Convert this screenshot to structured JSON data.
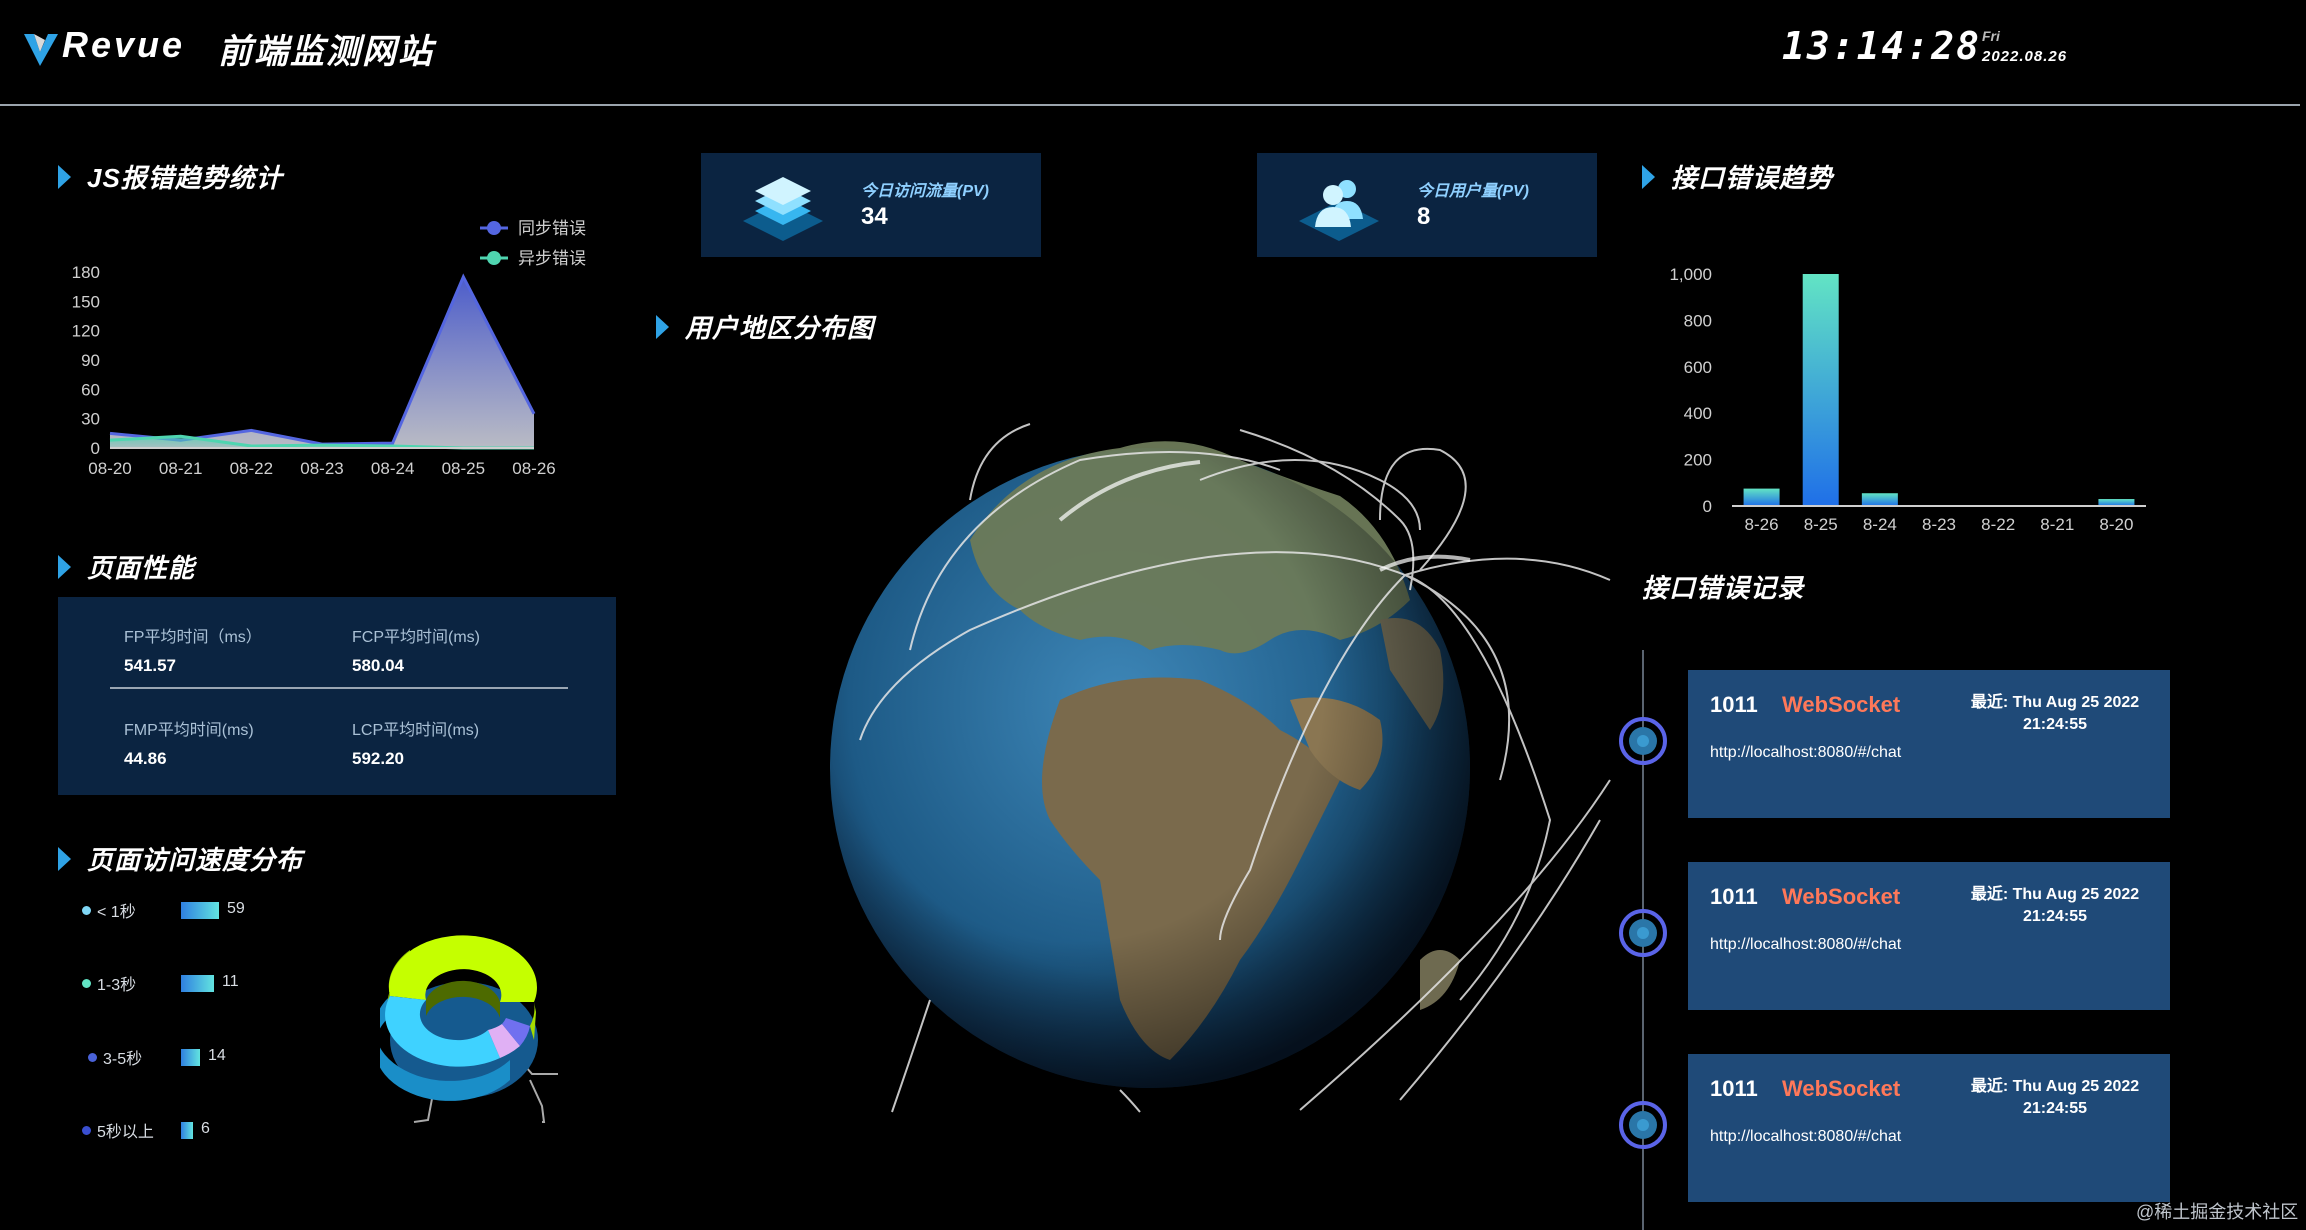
{
  "header": {
    "logo_text": "Revue",
    "site_title": "前端监测网站",
    "clock": "13:14:28",
    "weekday": "Fri",
    "date": "2022.08.26"
  },
  "colors": {
    "accent": "#2fa3e6",
    "panel": "#0b2441",
    "record_card": "#1f4a78",
    "error_type": "#ff7859",
    "sync_series": "#5466e0",
    "async_series": "#4fd5b0"
  },
  "sections": {
    "js_errors": "JS报错趋势统计",
    "performance": "页面性能",
    "speed": "页面访问速度分布",
    "region": "用户地区分布图",
    "api_trend": "接口错误趋势",
    "api_records": "接口错误记录"
  },
  "kpis": [
    {
      "label": "今日访问流量(PV)",
      "value": "34",
      "icon": "stack-icon"
    },
    {
      "label": "今日用户量(PV)",
      "value": "8",
      "icon": "users-icon"
    }
  ],
  "performance": {
    "items": [
      {
        "label": "FP平均时间（ms）",
        "value": "541.57"
      },
      {
        "label": "FCP平均时间(ms)",
        "value": "580.04"
      },
      {
        "label": "FMP平均时间(ms)",
        "value": "44.86"
      },
      {
        "label": "LCP平均时间(ms)",
        "value": "592.20"
      }
    ]
  },
  "speed": {
    "items": [
      {
        "label": "< 1秒",
        "value": 59,
        "color": "#7fd6f5"
      },
      {
        "label": "1-3秒",
        "value": 11,
        "color": "#62e4c4"
      },
      {
        "label": "3-5秒",
        "value": 14,
        "color": "#4a62d8"
      },
      {
        "label": "5秒以上",
        "value": 6,
        "color": "#3a4fd0"
      }
    ]
  },
  "api_records": [
    {
      "code": "1011",
      "type": "WebSocket",
      "time_line1": "最近: Thu Aug 25 2022",
      "time_line2": "21:24:55",
      "url": "http://localhost:8080/#/chat"
    },
    {
      "code": "1011",
      "type": "WebSocket",
      "time_line1": "最近: Thu Aug 25 2022",
      "time_line2": "21:24:55",
      "url": "http://localhost:8080/#/chat"
    },
    {
      "code": "1011",
      "type": "WebSocket",
      "time_line1": "最近: Thu Aug 25 2022",
      "time_line2": "21:24:55",
      "url": "http://localhost:8080/#/chat"
    }
  ],
  "chart_data": [
    {
      "type": "area",
      "categories": [
        "08-20",
        "08-21",
        "08-22",
        "08-23",
        "08-24",
        "08-25",
        "08-26"
      ],
      "series": [
        {
          "name": "同步错误",
          "values": [
            15,
            8,
            18,
            4,
            5,
            175,
            35
          ]
        },
        {
          "name": "异步错误",
          "values": [
            8,
            12,
            2,
            3,
            2,
            0,
            0
          ]
        }
      ],
      "yticks": [
        0,
        30,
        60,
        90,
        120,
        150,
        180
      ],
      "ylim": [
        0,
        180
      ],
      "legend": "top-right",
      "grid": false
    },
    {
      "type": "bar",
      "categories": [
        "8-26",
        "8-25",
        "8-24",
        "8-23",
        "8-22",
        "8-21",
        "8-20"
      ],
      "values": [
        75,
        1000,
        55,
        0,
        0,
        0,
        30
      ],
      "yticks": [
        "0",
        "200",
        "400",
        "600",
        "800",
        "1,000"
      ],
      "ylim": [
        0,
        1000
      ],
      "grid": false
    },
    {
      "type": "pie",
      "style": "3d-donut",
      "values": [
        59,
        11,
        14,
        6
      ],
      "colors": [
        "#b9f200",
        "#2ab8f0",
        "#d9a7f0",
        "#6f6cf0"
      ]
    }
  ],
  "watermark": "@稀土掘金技术社区"
}
